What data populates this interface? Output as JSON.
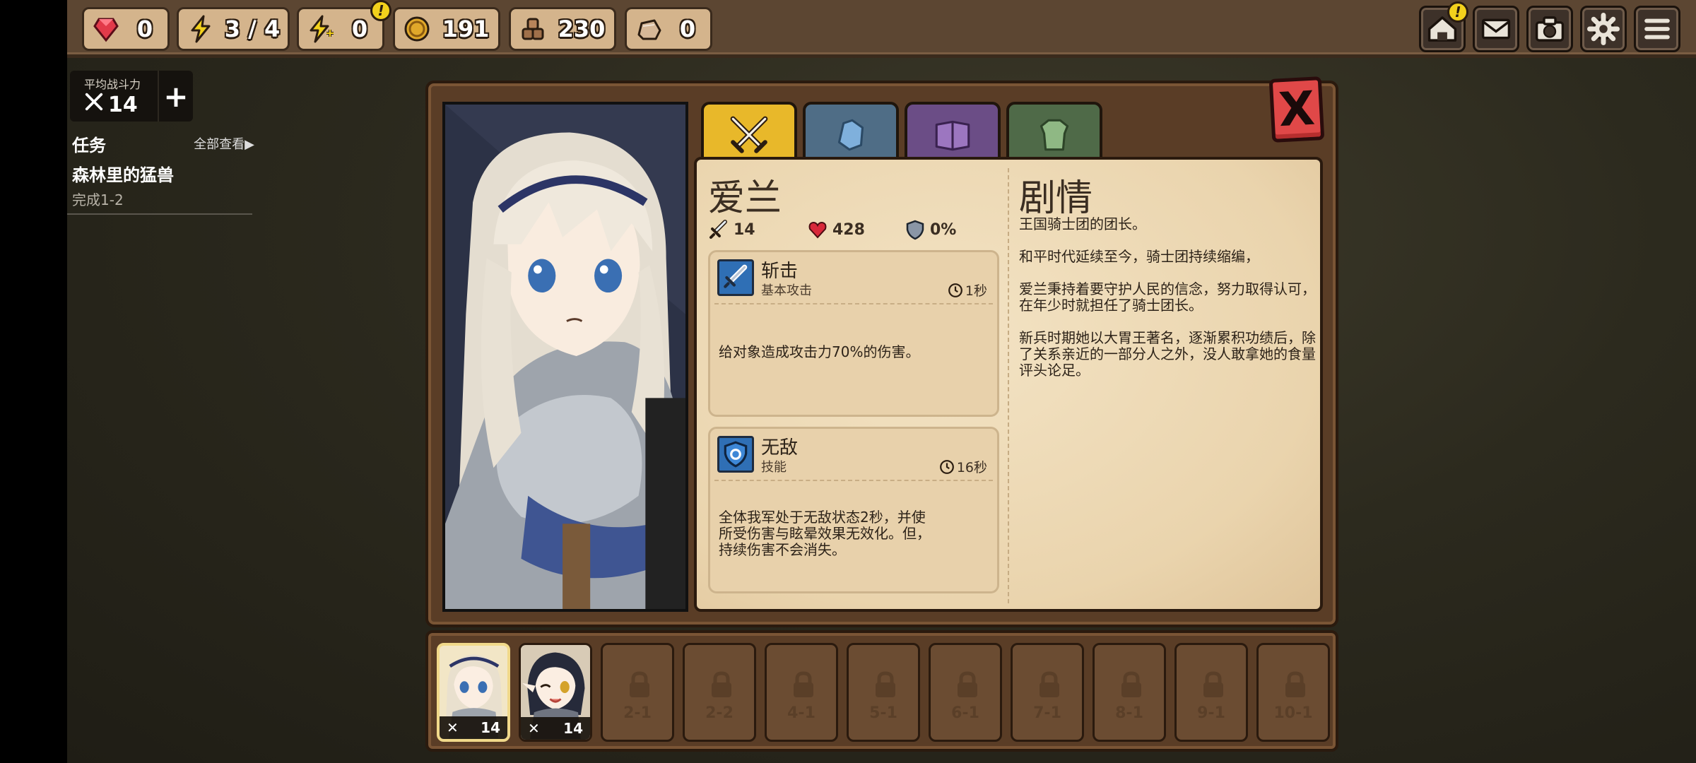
{
  "topbar": {
    "resources": [
      {
        "name": "gems",
        "icon": "ruby-gem-icon",
        "value": "0"
      },
      {
        "name": "energy",
        "icon": "lightning-icon",
        "value": "3 / 4"
      },
      {
        "name": "bonus_energy",
        "icon": "lightning-plus-icon",
        "value": "0"
      },
      {
        "name": "gold",
        "icon": "gold-coin-icon",
        "value": "191"
      },
      {
        "name": "ore",
        "icon": "ore-rocks-icon",
        "value": "230"
      },
      {
        "name": "stone",
        "icon": "stone-chunk-icon",
        "value": "0"
      }
    ],
    "buttons": [
      "home-icon",
      "mail-icon",
      "camera-icon",
      "settings-gear-icon",
      "menu-icon"
    ],
    "alert_glyph": "!"
  },
  "sidebar": {
    "power_label": "平均战斗力",
    "power_value": "14",
    "add_glyph": "+",
    "quest_header": "任务",
    "view_all": "全部查看▶",
    "quest_title": "森林里的猛兽",
    "quest_progress": "完成1-2"
  },
  "hero": {
    "name": "爱兰",
    "attack": "14",
    "hp": "428",
    "defense": "0%"
  },
  "skills": [
    {
      "name": "斩击",
      "type": "基本攻击",
      "cooldown": "1秒",
      "description": "给对象造成攻击力70%的伤害。"
    },
    {
      "name": "无敌",
      "type": "技能",
      "cooldown": "16秒",
      "description": "全体我军处于无敌状态2秒，并使所受伤害与眩晕效果无效化。但，持续伤害不会消失。"
    }
  ],
  "story": {
    "title": "剧情",
    "paragraphs": [
      "王国骑士团的团长。",
      "和平时代延续至今，骑士团持续缩编，",
      "爱兰秉持着要守护人民的信念，努力取得认可，在年少时就担任了骑士团长。",
      "新兵时期她以大胃王著名，逐渐累积功绩后，除了关系亲近的一部分人之外，没人敢拿她的食量评头论足。"
    ]
  },
  "tabs": [
    {
      "name": "tab-combat",
      "icon": "crossed-swords-icon",
      "color": "#e8b82a",
      "active": true
    },
    {
      "name": "tab-gear",
      "icon": "gauntlet-icon",
      "color": "#4f6d86",
      "active": false
    },
    {
      "name": "tab-skillbook",
      "icon": "book-icon",
      "color": "#6b4d86",
      "active": false
    },
    {
      "name": "tab-armor",
      "icon": "armor-icon",
      "color": "#4f6a48",
      "active": false
    }
  ],
  "close_glyph": "X",
  "roster": {
    "heroes": [
      {
        "name": "爱兰",
        "power": "14",
        "selected": true
      },
      {
        "name": "elf-hero",
        "power": "14",
        "selected": false
      }
    ],
    "locked": [
      "2-1",
      "2-2",
      "4-1",
      "5-1",
      "6-1",
      "7-1",
      "8-1",
      "9-1",
      "10-1"
    ]
  },
  "colors": {
    "accent_gold": "#e8b82a",
    "close_red": "#e04848",
    "paper": "#ead4ad",
    "frame_brown": "#5a3d26"
  }
}
